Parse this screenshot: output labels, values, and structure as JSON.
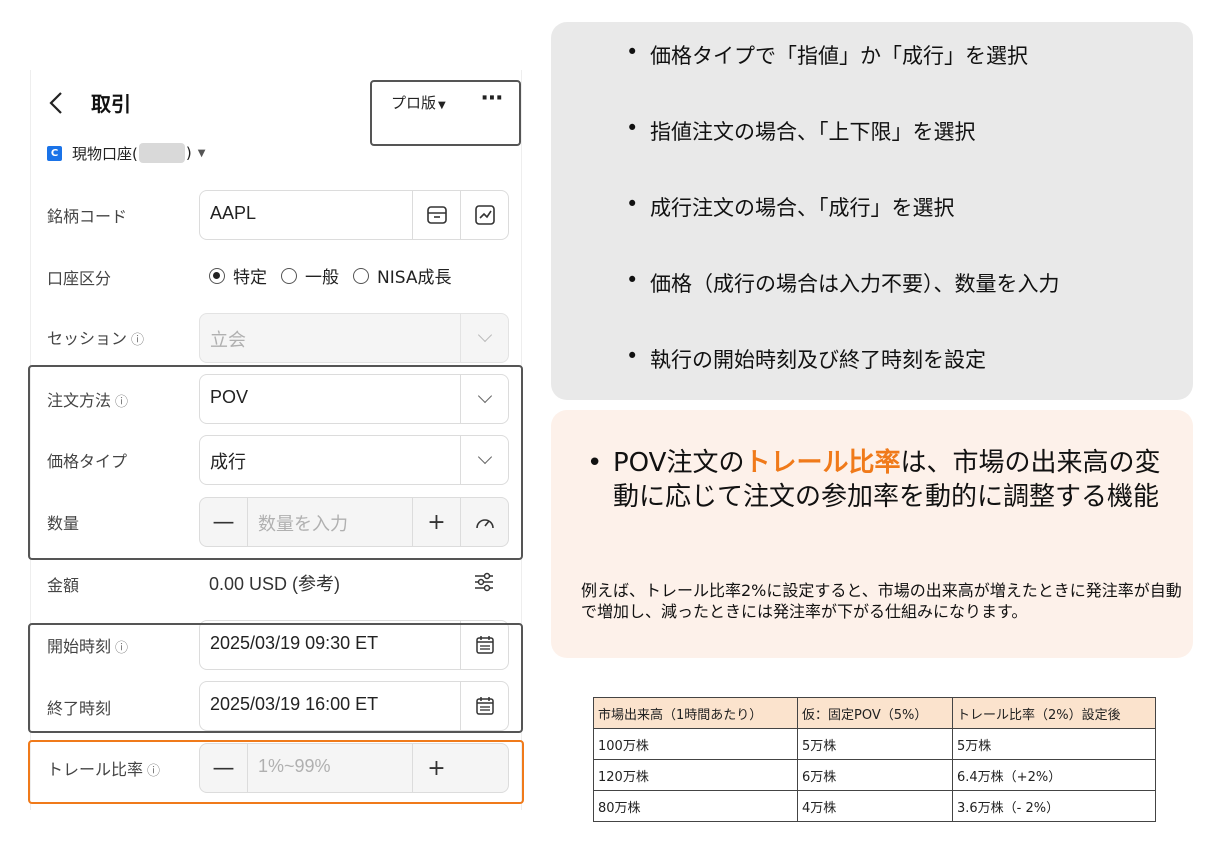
{
  "header": {
    "title": "取引",
    "pro_label": "プロ版",
    "more_label": "⋯"
  },
  "account": {
    "icon_letter": "C",
    "prefix": "現物口座(",
    "suffix": ")"
  },
  "form": {
    "symbol_label": "銘柄コード",
    "symbol_value": "AAPL",
    "account_type_label": "口座区分",
    "account_options": [
      "特定",
      "一般",
      "NISA成長"
    ],
    "selected_account_option": "特定",
    "session_label": "セッション",
    "session_value": "立会",
    "order_method_label": "注文方法",
    "order_method_value": "POV",
    "price_type_label": "価格タイプ",
    "price_type_value": "成行",
    "quantity_label": "数量",
    "quantity_placeholder": "数量を入力",
    "amount_label": "金額",
    "amount_value": "0.00 USD (参考)",
    "start_label": "開始時刻",
    "start_value": "2025/03/19 09:30 ET",
    "end_label": "終了時刻",
    "end_value": "2025/03/19 16:00 ET",
    "trail_label": "トレール比率",
    "trail_placeholder": "1%~99%",
    "minus": "—",
    "plus": "+",
    "info_glyph": "ⓘ"
  },
  "steps": [
    "価格タイプで「指値」か「成行」を選択",
    "指値注文の場合、「上下限」を選択",
    "成行注文の場合、「成行」を選択",
    "価格（成行の場合は入力不要）、数量を入力",
    "執行の開始時刻及び終了時刻を設定"
  ],
  "explanation": {
    "lead": "POV注文の",
    "highlight": "トレール比率",
    "rest": "は、市場の出来高の変動に応じて注文の参加率を動的に調整する機能",
    "example": "例えば、トレール比率2%に設定すると、市場の出来高が増えたときに発注率が自動で増加し、減ったときには発注率が下がる仕組みになります。"
  },
  "example_table": {
    "headers": [
      "市場出来高（1時間あたり）",
      "仮：固定POV（5%）",
      "トレール比率（2%）設定後"
    ],
    "rows": [
      [
        "100万株",
        "5万株",
        "5万株"
      ],
      [
        "120万株",
        "6万株",
        "6.4万株（+2%）"
      ],
      [
        "80万株",
        "4万株",
        "3.6万株（- 2%）"
      ]
    ]
  },
  "colors": {
    "accent_orange": "#f07a1a",
    "brand_blue": "#1a73e8",
    "grey_card": "#e9e9e9",
    "peach_card": "#fdf1ea",
    "table_header": "#fbe3cd"
  }
}
